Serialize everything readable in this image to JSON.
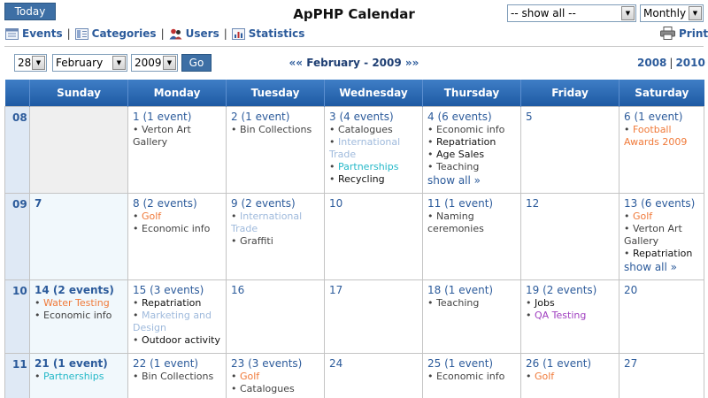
{
  "header": {
    "today_label": "Today",
    "title": "ApPHP Calendar",
    "filter_value": "-- show all --",
    "view_value": "Monthly"
  },
  "toolbar": {
    "events_label": "Events",
    "categories_label": "Categories",
    "users_label": "Users",
    "statistics_label": "Statistics",
    "separator": "|",
    "print_label": "Print"
  },
  "nav": {
    "day_value": "28",
    "month_value": "February",
    "year_value": "2009",
    "go_label": "Go",
    "prev_symbol": "««",
    "current_label": "February - 2009",
    "next_symbol": "»»",
    "prev_year": "2008",
    "next_year": "2010",
    "year_sep": "|"
  },
  "colors": {
    "header_blue": "#2a64ac",
    "link_blue": "#2c5b9b",
    "orange": "#f07a3a",
    "light_blue": "#9fbadc",
    "cyan": "#25b8c8",
    "purple": "#a040c0",
    "black": "#111111",
    "gray": "#444444"
  },
  "calendar": {
    "weekdays": [
      "Sunday",
      "Monday",
      "Tuesday",
      "Wednesday",
      "Thursday",
      "Friday",
      "Saturday"
    ],
    "weeks": [
      {
        "week": "08",
        "days": [
          {
            "empty": true
          },
          {
            "label": "1 (1 event)",
            "events": [
              {
                "text": "Verton Art Gallery",
                "color": "gray"
              }
            ]
          },
          {
            "label": "2 (1 event)",
            "events": [
              {
                "text": "Bin Collections",
                "color": "gray"
              }
            ]
          },
          {
            "label": "3 (4 events)",
            "events": [
              {
                "text": "Catalogues",
                "color": "gray"
              },
              {
                "text": "International Trade",
                "color": "light_blue"
              },
              {
                "text": "Partnerships",
                "color": "cyan"
              },
              {
                "text": "Recycling",
                "color": "black"
              }
            ]
          },
          {
            "label": "4 (6 events)",
            "events": [
              {
                "text": "Economic info",
                "color": "gray"
              },
              {
                "text": "Repatriation",
                "color": "black"
              },
              {
                "text": "Age Sales",
                "color": "black"
              },
              {
                "text": "Teaching",
                "color": "gray"
              }
            ],
            "show_all": "show all »"
          },
          {
            "label": "5",
            "events": []
          },
          {
            "label": "6 (1 event)",
            "events": [
              {
                "text": "Football Awards 2009",
                "color": "orange"
              }
            ]
          }
        ]
      },
      {
        "week": "09",
        "days": [
          {
            "label": "7",
            "events": [],
            "bold": true
          },
          {
            "label": "8 (2 events)",
            "events": [
              {
                "text": "Golf",
                "color": "orange"
              },
              {
                "text": "Economic info",
                "color": "gray"
              }
            ]
          },
          {
            "label": "9 (2 events)",
            "events": [
              {
                "text": "International Trade",
                "color": "light_blue"
              },
              {
                "text": "Graffiti",
                "color": "gray"
              }
            ]
          },
          {
            "label": "10",
            "events": []
          },
          {
            "label": "11 (1 event)",
            "events": [
              {
                "text": "Naming ceremonies",
                "color": "gray"
              }
            ]
          },
          {
            "label": "12",
            "events": []
          },
          {
            "label": "13 (6 events)",
            "events": [
              {
                "text": "Golf",
                "color": "orange"
              },
              {
                "text": "Verton Art Gallery",
                "color": "gray"
              },
              {
                "text": "Repatriation",
                "color": "black"
              }
            ],
            "show_all": "show all »"
          }
        ]
      },
      {
        "week": "10",
        "days": [
          {
            "label": "14 (2 events)",
            "bold": true,
            "events": [
              {
                "text": "Water Testing",
                "color": "orange"
              },
              {
                "text": "Economic info",
                "color": "gray"
              }
            ]
          },
          {
            "label": "15 (3 events)",
            "events": [
              {
                "text": "Repatriation",
                "color": "black"
              },
              {
                "text": "Marketing and Design",
                "color": "light_blue"
              },
              {
                "text": "Outdoor activity",
                "color": "black"
              }
            ]
          },
          {
            "label": "16",
            "events": []
          },
          {
            "label": "17",
            "events": []
          },
          {
            "label": "18 (1 event)",
            "events": [
              {
                "text": "Teaching",
                "color": "gray"
              }
            ]
          },
          {
            "label": "19 (2 events)",
            "events": [
              {
                "text": "Jobs",
                "color": "black"
              },
              {
                "text": "QA Testing",
                "color": "purple"
              }
            ]
          },
          {
            "label": "20",
            "events": []
          }
        ]
      },
      {
        "week": "11",
        "days": [
          {
            "label": "21 (1 event)",
            "bold": true,
            "events": [
              {
                "text": "Partnerships",
                "color": "cyan"
              }
            ]
          },
          {
            "label": "22 (1 event)",
            "events": [
              {
                "text": "Bin Collections",
                "color": "gray"
              }
            ]
          },
          {
            "label": "23 (3 events)",
            "events": [
              {
                "text": "Golf",
                "color": "orange"
              },
              {
                "text": "Catalogues",
                "color": "gray"
              }
            ]
          },
          {
            "label": "24",
            "events": []
          },
          {
            "label": "25 (1 event)",
            "events": [
              {
                "text": "Economic info",
                "color": "gray"
              }
            ]
          },
          {
            "label": "26 (1 event)",
            "events": [
              {
                "text": "Golf",
                "color": "orange"
              }
            ]
          },
          {
            "label": "27",
            "events": []
          }
        ]
      }
    ]
  }
}
